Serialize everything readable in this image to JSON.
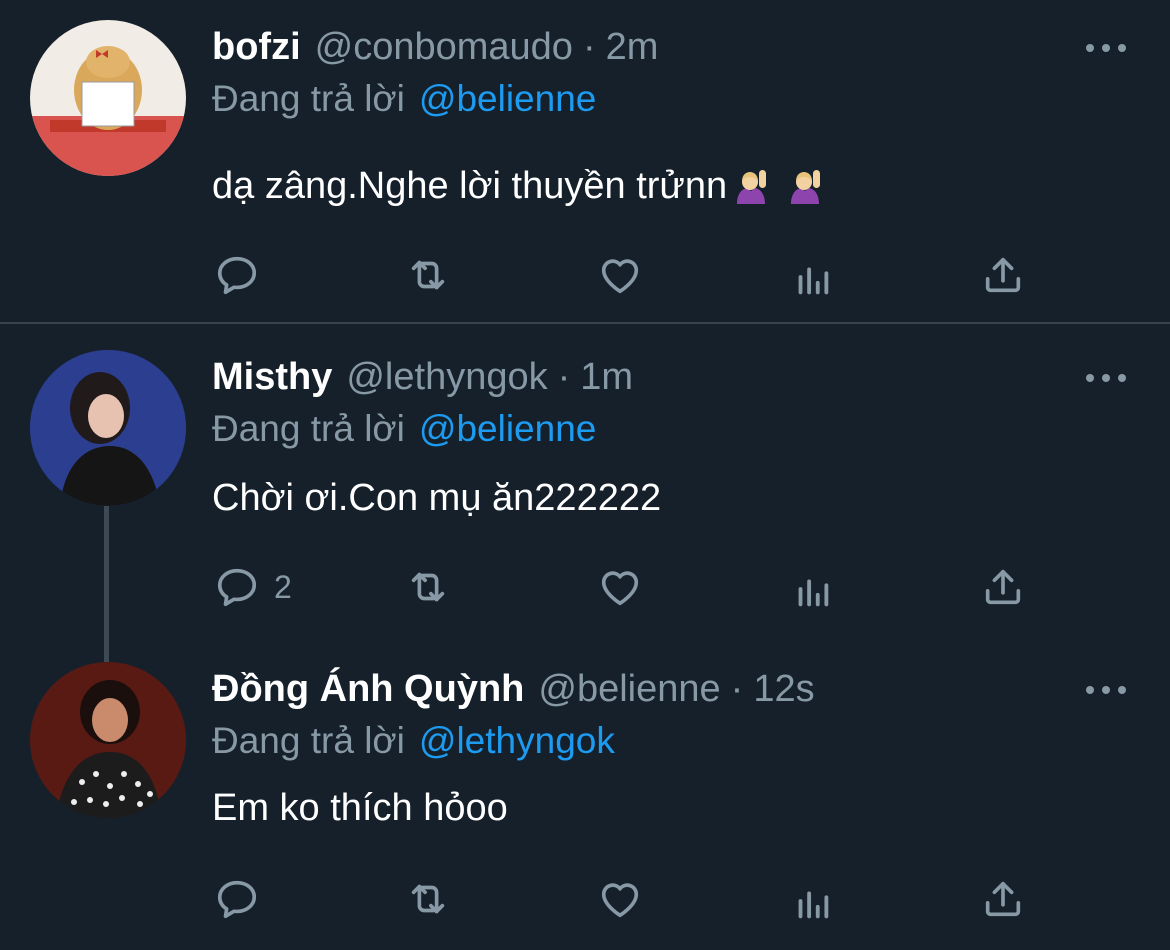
{
  "tweets": [
    {
      "name": "bofzi",
      "handle": "@conbomaudo",
      "separator": "·",
      "time": "2m",
      "reply_prefix": "Đang trả lời",
      "reply_to": "@belienne",
      "text": "dạ zâng.Nghe lời thuyền trửnn",
      "emojis": [
        "raising-hand-emoji",
        "raising-hand-emoji"
      ],
      "actions": {
        "reply_count": "",
        "retweet_count": "",
        "like_count": ""
      }
    },
    {
      "name": "Misthy",
      "handle": "@lethyngok",
      "separator": "·",
      "time": "1m",
      "reply_prefix": "Đang trả lời",
      "reply_to": "@belienne",
      "text": "Chời ơi.Con mụ ăn222222",
      "actions": {
        "reply_count": "2",
        "retweet_count": "",
        "like_count": ""
      }
    },
    {
      "name": "Đồng Ánh Quỳnh",
      "handle": "@belienne",
      "separator": "·",
      "time": "12s",
      "reply_prefix": "Đang trả lời",
      "reply_to": "@lethyngok",
      "text": "Em ko thích hỏoo",
      "actions": {
        "reply_count": "",
        "retweet_count": "",
        "like_count": ""
      }
    }
  ],
  "icons": {
    "more": "more-dots-icon",
    "reply": "reply-bubble-icon",
    "retweet": "retweet-arrows-icon",
    "like": "heart-icon",
    "analytics": "analytics-bars-icon",
    "share": "share-upload-icon"
  },
  "colors": {
    "background": "#15202b",
    "divider": "#38444d",
    "secondary_text": "#8899a6",
    "mention": "#1d9bf0",
    "primary_text": "#ffffff"
  }
}
